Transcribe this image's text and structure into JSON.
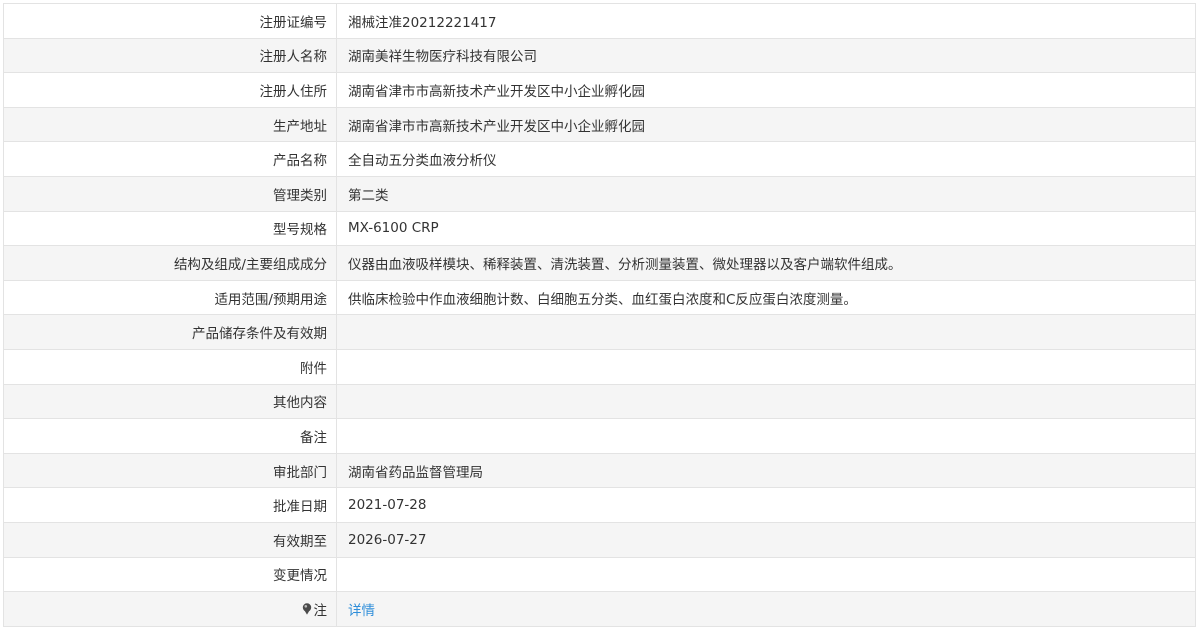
{
  "rows": [
    {
      "label": "注册证编号",
      "value": "湘械注准20212221417"
    },
    {
      "label": "注册人名称",
      "value": "湖南美祥生物医疗科技有限公司"
    },
    {
      "label": "注册人住所",
      "value": "湖南省津市市高新技术产业开发区中小企业孵化园"
    },
    {
      "label": "生产地址",
      "value": "湖南省津市市高新技术产业开发区中小企业孵化园"
    },
    {
      "label": "产品名称",
      "value": "全自动五分类血液分析仪"
    },
    {
      "label": "管理类别",
      "value": "第二类"
    },
    {
      "label": "型号规格",
      "value": "MX-6100 CRP"
    },
    {
      "label": "结构及组成/主要组成成分",
      "value": "仪器由血液吸样模块、稀释装置、清洗装置、分析测量装置、微处理器以及客户端软件组成。"
    },
    {
      "label": "适用范围/预期用途",
      "value": "供临床检验中作血液细胞计数、白细胞五分类、血红蛋白浓度和C反应蛋白浓度测量。"
    },
    {
      "label": "产品储存条件及有效期",
      "value": ""
    },
    {
      "label": "附件",
      "value": ""
    },
    {
      "label": "其他内容",
      "value": ""
    },
    {
      "label": "备注",
      "value": ""
    },
    {
      "label": "审批部门",
      "value": "湖南省药品监督管理局"
    },
    {
      "label": "批准日期",
      "value": "2021-07-28"
    },
    {
      "label": "有效期至",
      "value": "2026-07-27"
    },
    {
      "label": "变更情况",
      "value": ""
    }
  ],
  "note_row": {
    "icon": "pin-icon",
    "label": "注",
    "link_text": "详情",
    "link_color": "#2f8ed9"
  }
}
